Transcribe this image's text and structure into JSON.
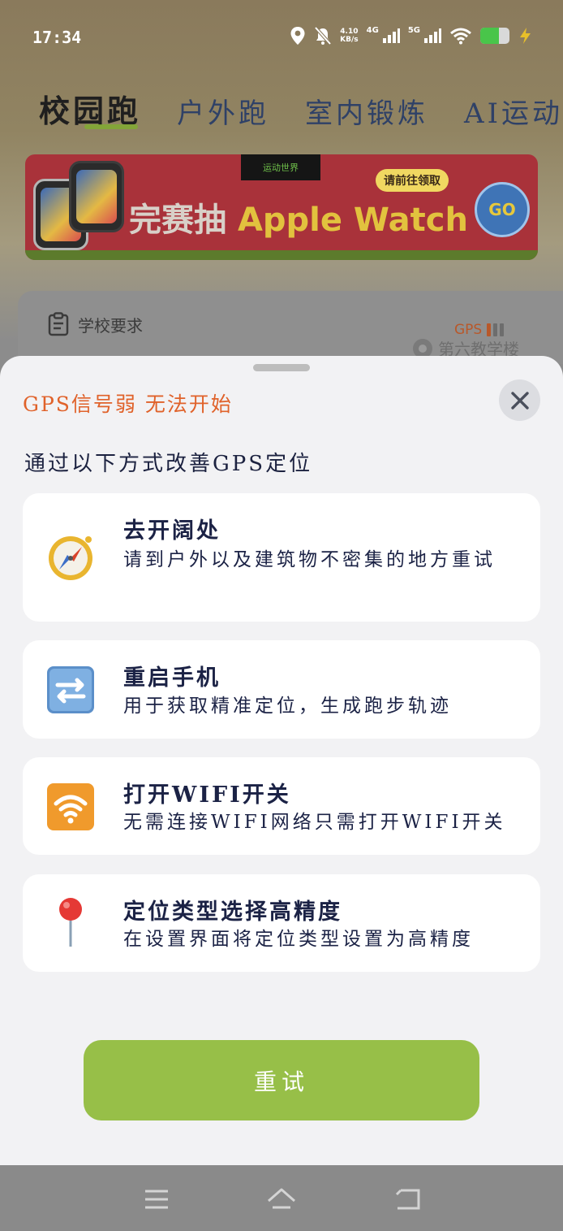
{
  "status_bar": {
    "time": "17:34",
    "net_speed_value": "4.10",
    "net_speed_unit": "KB/s",
    "network_1": "4G",
    "network_2": "5G",
    "battery_level": 0.65
  },
  "tabs": [
    {
      "label": "校园跑",
      "active": true
    },
    {
      "label": "户外跑",
      "active": false
    },
    {
      "label": "室内锻炼",
      "active": false
    },
    {
      "label": "AI运动",
      "active": false
    }
  ],
  "banner": {
    "brand": "运动世界",
    "text_cn": "完赛抽",
    "text_en": "Apple Watch",
    "cta": "请前往领取",
    "go": "GO"
  },
  "map": {
    "school_requirements": "学校要求",
    "gps_label": "GPS",
    "gps_signal_bars": 1,
    "place_label": "第六教学楼"
  },
  "sheet": {
    "title": "GPS信号弱 无法开始",
    "subtitle": "通过以下方式改善GPS定位",
    "tips": [
      {
        "icon": "compass-icon",
        "title": "去开阔处",
        "desc": "请到户外以及建筑物不密集的地方重试"
      },
      {
        "icon": "restart-icon",
        "title": "重启手机",
        "desc": "用于获取精准定位，生成跑步轨迹"
      },
      {
        "icon": "wifi-icon",
        "title": "打开WIFI开关",
        "desc": "无需连接WIFI网络只需打开WIFI开关"
      },
      {
        "icon": "location-pin-icon",
        "title": "定位类型选择高精度",
        "desc": "在设置界面将定位类型设置为高精度"
      }
    ],
    "retry_label": "重试"
  },
  "colors": {
    "accent_green": "#97bf48",
    "warning_orange": "#e0622a",
    "text_navy": "#1b2245"
  }
}
